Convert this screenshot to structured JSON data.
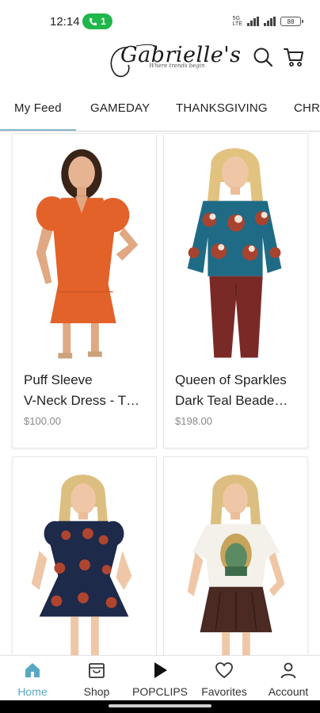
{
  "status_bar": {
    "time": "12:14",
    "call_count": "1",
    "network_top": "5G",
    "network_bottom": "LTE",
    "battery": "88"
  },
  "header": {
    "brand": "Gabrielle's",
    "tagline": "Where trends begin"
  },
  "tabs": [
    {
      "label": "My Feed",
      "active": true
    },
    {
      "label": "GAMEDAY"
    },
    {
      "label": "THANKSGIVING"
    },
    {
      "label": "CHRI"
    }
  ],
  "products": [
    {
      "title_line1": "Puff Sleeve",
      "title_line2": "V-Neck Dress - T…",
      "price": "$100.00"
    },
    {
      "title_line1": "Queen of Sparkles",
      "title_line2": "Dark Teal Beade…",
      "price": "$198.00"
    },
    {
      "title_line1": "",
      "title_line2": "",
      "price": ""
    },
    {
      "title_line1": "",
      "title_line2": "",
      "price": ""
    }
  ],
  "bottom_nav": [
    {
      "label": "Home",
      "icon": "home-icon",
      "active": true
    },
    {
      "label": "Shop",
      "icon": "shop-icon"
    },
    {
      "label": "POPCLIPS",
      "icon": "play-icon"
    },
    {
      "label": "Favorites",
      "icon": "heart-icon"
    },
    {
      "label": "Account",
      "icon": "person-icon"
    }
  ],
  "colors": {
    "accent": "#5aa7c3",
    "call_pill": "#1fb64a",
    "orange_dress": "#e2622a",
    "teal_sweater": "#1f6b85",
    "navy_dress": "#1e2a4a",
    "leather_brown": "#4a2a22"
  }
}
